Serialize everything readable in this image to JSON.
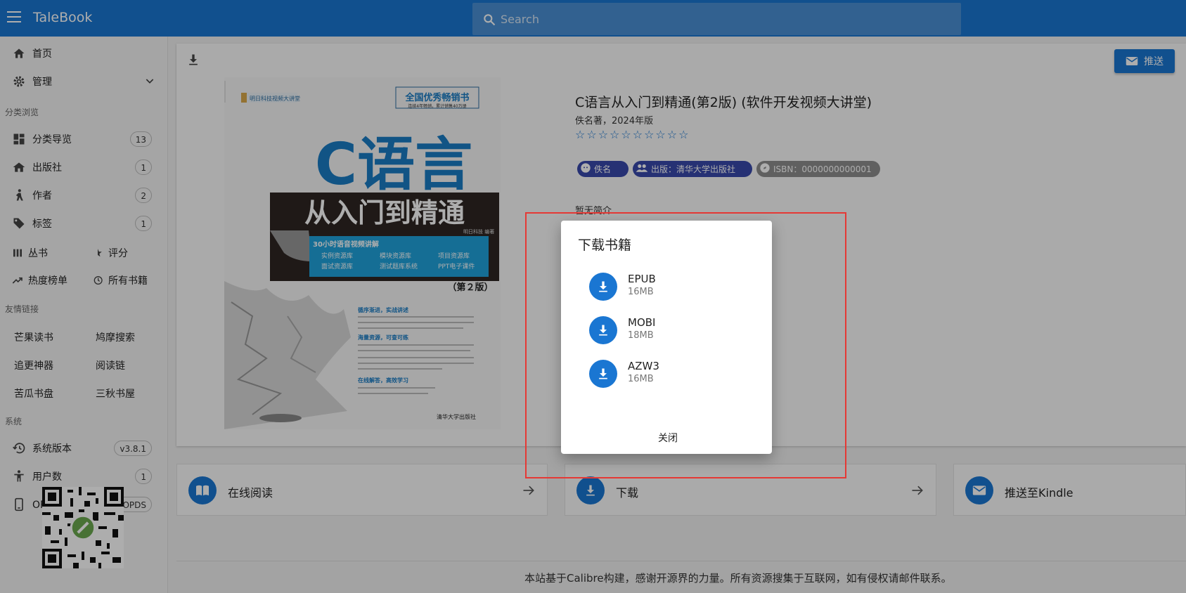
{
  "app": {
    "title": "TaleBook"
  },
  "search": {
    "placeholder": "Search"
  },
  "sidebar": {
    "home": "首页",
    "manage": "管理",
    "section_browse": "分类浏览",
    "browse_items": [
      {
        "label": "分类导览",
        "count": "13"
      },
      {
        "label": "出版社",
        "count": "1"
      },
      {
        "label": "作者",
        "count": "2"
      },
      {
        "label": "标签",
        "count": "1"
      }
    ],
    "series": "丛书",
    "rating": "评分",
    "hot": "热度榜单",
    "all_books": "所有书籍",
    "section_links": "友情链接",
    "links": [
      "芒果读书",
      "鸠摩搜索",
      "追更神器",
      "阅读链",
      "苦瓜书盘",
      "三秋书屋"
    ],
    "section_system": "系统",
    "system_items": [
      {
        "label": "系统版本",
        "value": "v3.8.1"
      },
      {
        "label": "用户数",
        "value": "1"
      },
      {
        "label": "OPDS接口",
        "value": "OPDS"
      }
    ]
  },
  "book": {
    "title": "C语言从入门到精通(第2版) (软件开发视频大讲堂)",
    "subtitle": "佚名著，2024年版",
    "stars": "☆☆☆☆☆☆☆☆☆☆",
    "chips": {
      "author": "佚名",
      "publisher": "出版：清华大学出版社",
      "isbn": "ISBN：0000000000001"
    },
    "intro": "暂无简介",
    "push_label": "推送"
  },
  "cover": {
    "banner_top": "全国优秀畅销书",
    "banner_small": "连续4年畅销，累计销售40万册",
    "brand": "明日科技视频大讲堂",
    "big_title": "C语言",
    "subtitle": "从入门到精通",
    "strip_title": "30小时语音视频讲解",
    "strip_items": [
      "实例资源库",
      "模块资源库",
      "项目资源库",
      "面试资源库",
      "测试题库系统",
      "PPT电子课件"
    ],
    "edition": "（第２版）",
    "publisher": "清华大学出版社",
    "author_tag": "明日科技 编著",
    "blurb_1": "循序渐进，实战讲述",
    "blurb_2": "海量资源，可查可练",
    "blurb_3": "在线解答，高效学习"
  },
  "actions": [
    {
      "label": "在线阅读"
    },
    {
      "label": "下载"
    },
    {
      "label": "推送至Kindle"
    }
  ],
  "footer": {
    "text": "本站基于Calibre构建，感谢开源界的力量。所有资源搜集于互联网，如有侵权请邮件联系。"
  },
  "dialog": {
    "title": "下载书籍",
    "formats": [
      {
        "name": "EPUB",
        "size": "16MB"
      },
      {
        "name": "MOBI",
        "size": "18MB"
      },
      {
        "name": "AZW3",
        "size": "16MB"
      }
    ],
    "close_label": "关闭"
  },
  "colors": {
    "primary": "#1a76d2",
    "chip": "#3949ab",
    "chip_gray": "#8e8e8e",
    "highlight": "#e53935"
  }
}
